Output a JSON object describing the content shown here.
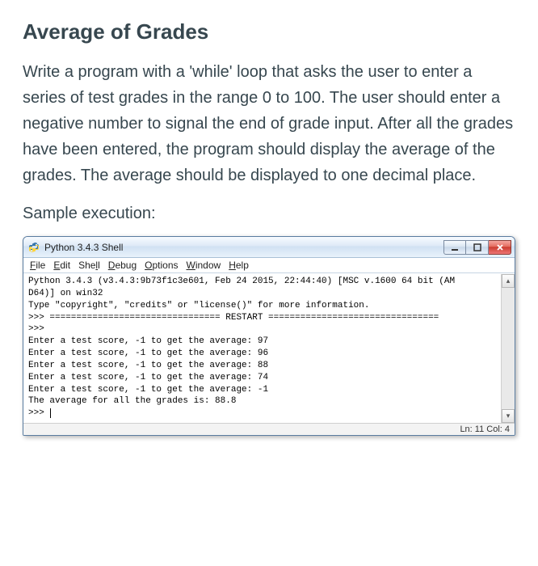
{
  "heading": "Average of Grades",
  "description": "Write a program with a 'while' loop that asks the user to enter a series of test grades in the range 0 to 100. The user should enter a negative number to signal the end of grade input. After all the grades have been entered, the program should display the average of the grades. The average should be displayed to one decimal place.",
  "sample_label": "Sample execution:",
  "window": {
    "title": "Python 3.4.3 Shell",
    "menubar": [
      "File",
      "Edit",
      "Shell",
      "Debug",
      "Options",
      "Window",
      "Help"
    ],
    "lines": [
      "Python 3.4.3 (v3.4.3:9b73f1c3e601, Feb 24 2015, 22:44:40) [MSC v.1600 64 bit (AM",
      "D64)] on win32",
      "Type \"copyright\", \"credits\" or \"license()\" for more information.",
      ">>> ================================ RESTART ================================",
      ">>> ",
      "Enter a test score, -1 to get the average: 97",
      "Enter a test score, -1 to get the average: 96",
      "Enter a test score, -1 to get the average: 88",
      "Enter a test score, -1 to get the average: 74",
      "Enter a test score, -1 to get the average: -1",
      "The average for all the grades is: 88.8",
      ">>> "
    ],
    "status": "Ln: 11 Col: 4"
  }
}
